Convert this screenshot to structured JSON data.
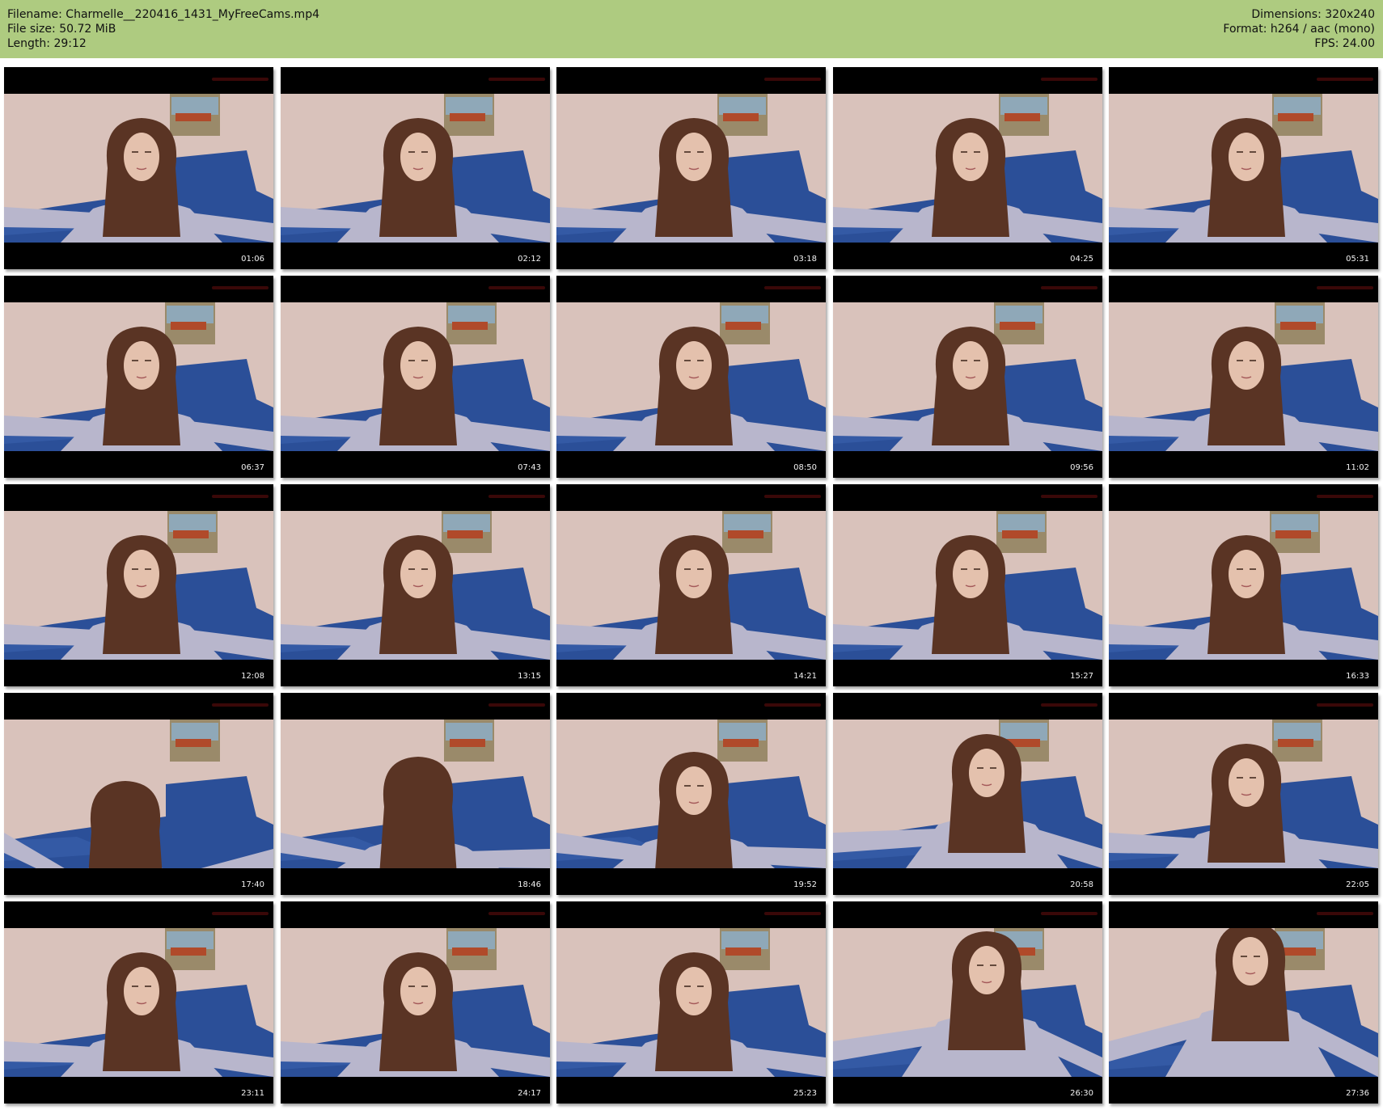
{
  "header": {
    "filename_line": "Filename: Charmelle__220416_1431_MyFreeCams.mp4",
    "filesize_line": "File size: 50.72 MiB",
    "length_line": "Length: 29:12",
    "dimensions_line": "Dimensions: 320x240",
    "format_line": "Format: h264 / aac (mono)",
    "fps_line": "FPS: 24.00"
  },
  "colors": {
    "header_bg": "#aecb80",
    "wall": "#d9c2bb",
    "blanket": "#2b4f98",
    "hair": "#5a3424",
    "sweater": "#b8b6cc"
  },
  "thumbnails": [
    {
      "time": "01:06"
    },
    {
      "time": "02:12"
    },
    {
      "time": "03:18"
    },
    {
      "time": "04:25"
    },
    {
      "time": "05:31"
    },
    {
      "time": "06:37"
    },
    {
      "time": "07:43"
    },
    {
      "time": "08:50"
    },
    {
      "time": "09:56"
    },
    {
      "time": "11:02"
    },
    {
      "time": "12:08"
    },
    {
      "time": "13:15"
    },
    {
      "time": "14:21"
    },
    {
      "time": "15:27"
    },
    {
      "time": "16:33"
    },
    {
      "time": "17:40"
    },
    {
      "time": "18:46"
    },
    {
      "time": "19:52"
    },
    {
      "time": "20:58"
    },
    {
      "time": "22:05"
    },
    {
      "time": "23:11"
    },
    {
      "time": "24:17"
    },
    {
      "time": "25:23"
    },
    {
      "time": "26:30"
    },
    {
      "time": "27:36"
    }
  ]
}
